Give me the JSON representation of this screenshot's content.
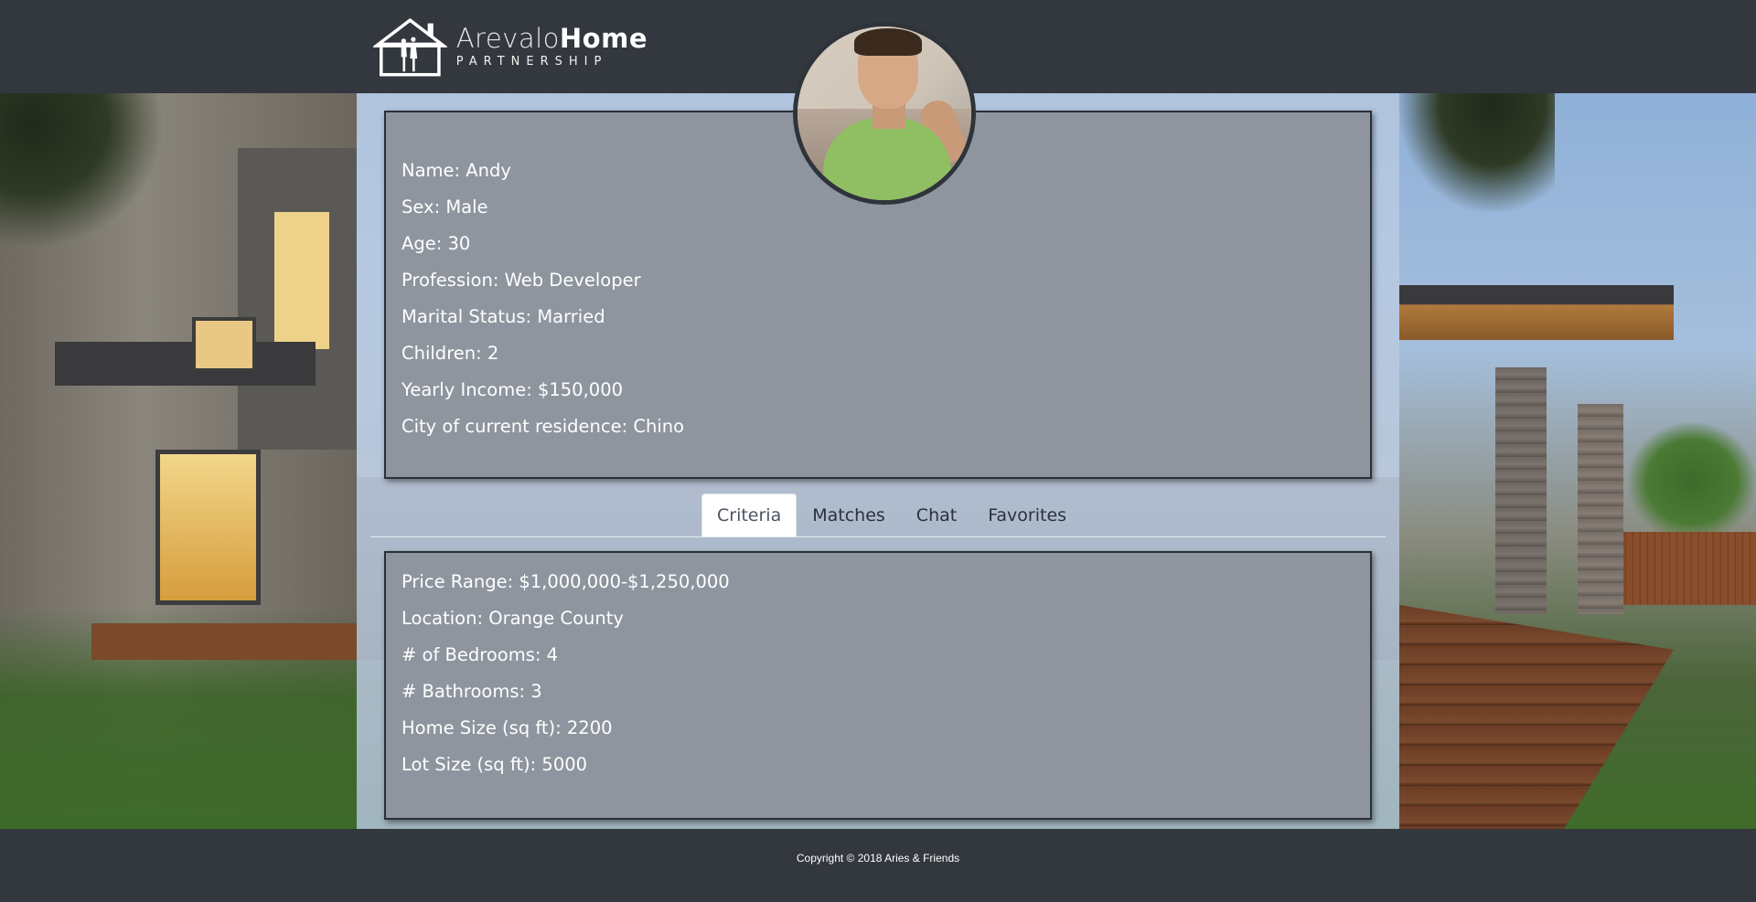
{
  "brand": {
    "name_light": "Arevalo",
    "name_bold": "Home",
    "subtitle": "PARTNERSHIP",
    "logo_icon": "house-couple-icon"
  },
  "profile": {
    "name": "Name: Andy",
    "sex": "Sex: Male",
    "age": "Age: 30",
    "profession": "Profession: Web Developer",
    "marital_status": "Marital Status: Married",
    "children": "Children: 2",
    "yearly_income": "Yearly Income: $150,000",
    "city": "City of current residence: Chino"
  },
  "tabs": [
    {
      "label": "Criteria",
      "active": true
    },
    {
      "label": "Matches",
      "active": false
    },
    {
      "label": "Chat",
      "active": false
    },
    {
      "label": "Favorites",
      "active": false
    }
  ],
  "criteria": {
    "price_range": "Price Range: $1,000,000-$1,250,000",
    "location": "Location: Orange County",
    "bedrooms": "# of Bedrooms: 4",
    "bathrooms": "# Bathrooms: 3",
    "home_size": "Home Size (sq ft): 2200",
    "lot_size": "Lot Size (sq ft): 5000"
  },
  "footer": {
    "copyright": "Copyright © 2018 Aries & Friends"
  },
  "colors": {
    "header_bg": "#33373e",
    "panel_bg": "#8e959e",
    "panel_border": "#2b2f35",
    "tab_active_bg": "#ffffff"
  }
}
